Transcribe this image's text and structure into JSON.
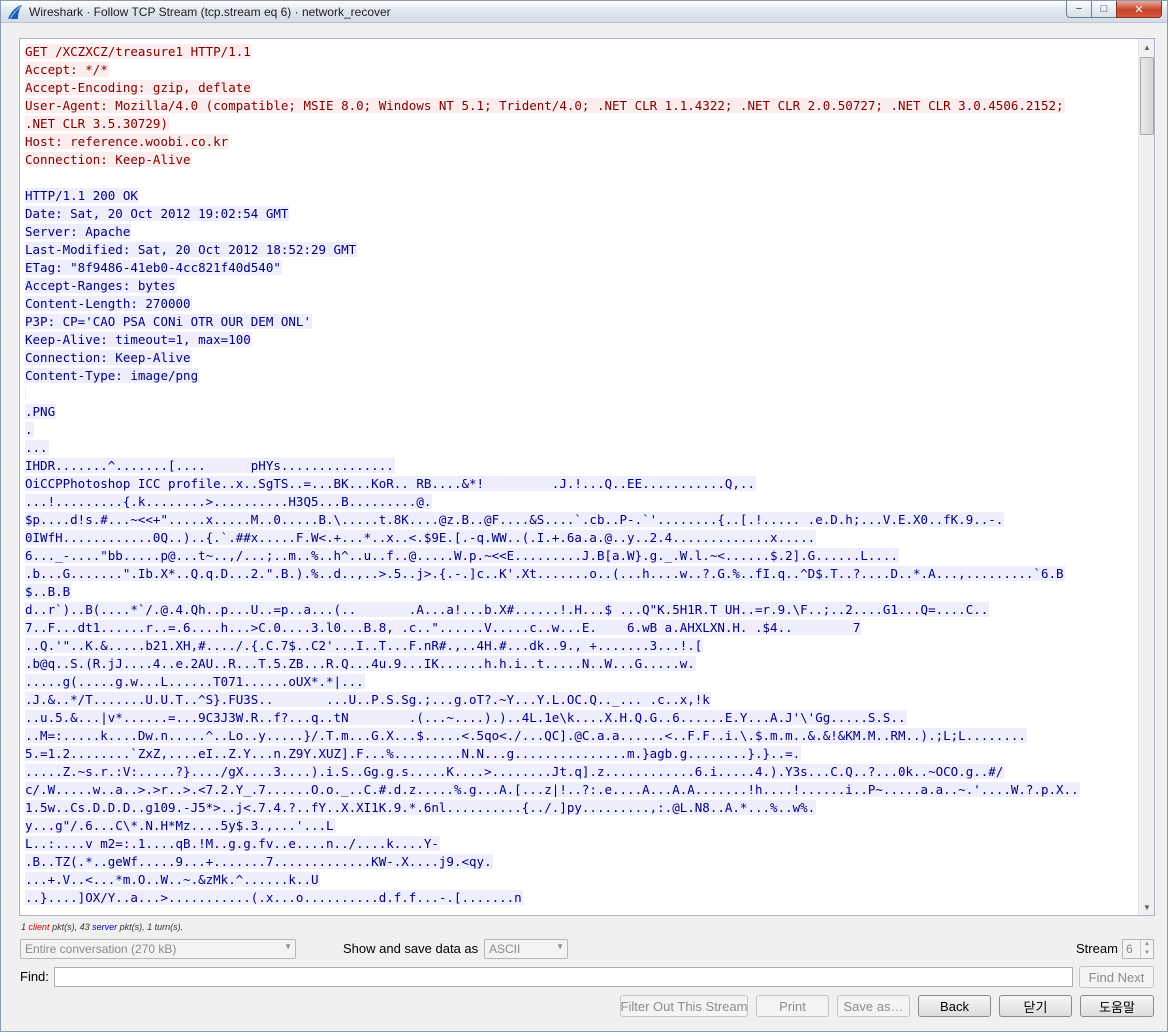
{
  "window": {
    "title": "Wireshark · Follow TCP Stream (tcp.stream eq 6) · network_recover",
    "minimize_glyph": "−",
    "maximize_glyph": "□",
    "close_glyph": "✕"
  },
  "stream": {
    "lines": [
      {
        "dir": "cli",
        "text": "GET /XCZXCZ/treasure1 HTTP/1.1"
      },
      {
        "dir": "cli",
        "text": "Accept: */*"
      },
      {
        "dir": "cli",
        "text": "Accept-Encoding: gzip, deflate"
      },
      {
        "dir": "cli",
        "text": "User-Agent: Mozilla/4.0 (compatible; MSIE 8.0; Windows NT 5.1; Trident/4.0; .NET CLR 1.1.4322; .NET CLR 2.0.50727; .NET CLR 3.0.4506.2152;"
      },
      {
        "dir": "cli",
        "text": ".NET CLR 3.5.30729)"
      },
      {
        "dir": "cli",
        "text": "Host: reference.woobi.co.kr"
      },
      {
        "dir": "cli",
        "text": "Connection: Keep-Alive"
      },
      {
        "dir": "blank",
        "text": ""
      },
      {
        "dir": "srv",
        "text": "HTTP/1.1 200 OK"
      },
      {
        "dir": "srv",
        "text": "Date: Sat, 20 Oct 2012 19:02:54 GMT"
      },
      {
        "dir": "srv",
        "text": "Server: Apache"
      },
      {
        "dir": "srv",
        "text": "Last-Modified: Sat, 20 Oct 2012 18:52:29 GMT"
      },
      {
        "dir": "srv",
        "text": "ETag: \"8f9486-41eb0-4cc821f40d540\""
      },
      {
        "dir": "srv",
        "text": "Accept-Ranges: bytes"
      },
      {
        "dir": "srv",
        "text": "Content-Length: 270000"
      },
      {
        "dir": "srv",
        "text": "P3P: CP='CAO PSA CONi OTR OUR DEM ONL'"
      },
      {
        "dir": "srv",
        "text": "Keep-Alive: timeout=1, max=100"
      },
      {
        "dir": "srv",
        "text": "Connection: Keep-Alive"
      },
      {
        "dir": "srv",
        "text": "Content-Type: image/png"
      },
      {
        "dir": "srv",
        "text": ""
      },
      {
        "dir": "srv",
        "text": ".PNG"
      },
      {
        "dir": "srv",
        "text": "."
      },
      {
        "dir": "srv",
        "text": "..."
      },
      {
        "dir": "srv",
        "text": "IHDR.......^.......[....      pHYs..............."
      },
      {
        "dir": "srv",
        "text": "OiCCPPhotoshop ICC profile..x..SgTS..=...BK...KoR.. RB....&*!         .J.!...Q..EE...........Q,.."
      },
      {
        "dir": "srv",
        "text": "...!.........{.k........>..........H3Q5...B.........@."
      },
      {
        "dir": "srv",
        "text": "$p....d!s.#...~<<+\".....x.....M..0.....B.\\.....t.8K....@z.B..@F....&S....`.cb..P-.`'........{..[.!..... .e.D.h;...V.E.X0..fK.9..-."
      },
      {
        "dir": "srv",
        "text": "0IWfH............0Q..)..{.`.##x.....F.W<.+...*..x..<.$9E.[.-q.WW..(.I.+.6a.a.@..y..2.4.............x....."
      },
      {
        "dir": "srv",
        "text": "6..._-....\"bb.....p@...t~..,/...;..m..%..h^..u..f..@.....W.p.~<<E.........J.B[a.W}.g._.W.l.~<......$.2].G......L...."
      },
      {
        "dir": "srv",
        "text": ".b...G.......\".Ib.X*..Q.q.D...2.\".B.).%..d..,..>.5..j>.{.-.]c..K'.Xt.......o..(...h....w..?.G.%..fI.q..^D$.T..?....D..*.A...,.........`6.B"
      },
      {
        "dir": "srv",
        "text": "$..B.B"
      },
      {
        "dir": "srv",
        "text": "d..r`)..B(....*`/.@.4.Qh..p...U..=p..a...(..       .A...a!...b.X#......!.H...$ ...Q\"K.5H1R.T UH..=r.9.\\F..;..2....G1...Q=....C.."
      },
      {
        "dir": "srv",
        "text": "7..F...dt1......r..=.6....h...>C.0....3.l0...B.8, .c..\"......V.....c..w...E.    6.wB a.AHXLXN.H. .$4..        7"
      },
      {
        "dir": "srv",
        "text": "..Q.'\"..K.&.....b21.XH,#..../.{.C.7$..C2'...I..T...F.nR#.,..4H.#...dk..9., +.......3...!.["
      },
      {
        "dir": "srv",
        "text": ".b@q..S.(R.jJ....4..e.2AU..R...T.5.ZB...R.Q...4u.9...IK......h.h.i..t.....N..W...G.....w."
      },
      {
        "dir": "srv",
        "text": ".....g(.....g.w...L......T071......oUX*.*|..."
      },
      {
        "dir": "srv",
        "text": ".J.&..*/T.......U.U.T..^S}.FU3S..       ...U..P.S.Sg.;...g.oT?.~Y...Y.L.OC.Q.._... .c..x,!k"
      },
      {
        "dir": "srv",
        "text": "..u.5.&...|v*......=...9C3J3W.R..f?...q..tN        .(...~....).)..4L.1e\\k....X.H.Q.G..6......E.Y...A.J'\\'Gg.....S.S.."
      },
      {
        "dir": "srv",
        "text": "..M=:.....k....Dw.n.....^..Lo..y.....}/.T.m...G.X...$.....<.5qo<./...QC].@C.a.a......<..F.F..i.\\.$.m.m..&.&!&KM.M..RM..).;L;L........"
      },
      {
        "dir": "srv",
        "text": "5.=1.2........`ZxZ,....eI..Z.Y...n.Z9Y.XUZ].F...%.........N.N...g...............m.}agb.g........}.}..=."
      },
      {
        "dir": "srv",
        "text": ".....Z.~s.r.:V:.....?}..../gX....3....).i.S..Gg.g.s.....K....>........Jt.q].z............6.i.....4.).Y3s...C.Q..?...0k..~OCO.g..#/"
      },
      {
        "dir": "srv",
        "text": "c/.W.....w..a..>.>r..>.<7.2.Y_.7......O.o._..C.#.d.z.....%.g...A.[...z|!..?:.e....A...A.A.......!h....!......i..P~.....a.a..~.'....W.?.p.X.."
      },
      {
        "dir": "srv",
        "text": "1.5w..Cs.D.D.D..g109.-J5*>..j<.7.4.?..fY..X.XI1K.9.*.6nl..........{../.]py.........,:.@L.N8..A.*...%..w%."
      },
      {
        "dir": "srv",
        "text": "y...g\"/.6...C\\*.N.H*Mz....5y$.3.,...'...L"
      },
      {
        "dir": "srv",
        "text": "L..:....v m2=:.1....qB.!M..g.g.fv..e....n../....k....Y-"
      },
      {
        "dir": "srv",
        "text": ".B..TZ(.*..geWf.....9...+.......7.............KW-.X....j9.<qy."
      },
      {
        "dir": "srv",
        "text": "...+.V..<...*m.O..W..~.&zMk.^......k..U"
      },
      {
        "dir": "srv",
        "text": "..}....]OX/Y..a...>...........(.x...o..........d.f.f...-.[.......n"
      }
    ]
  },
  "stats": {
    "client_count": "1",
    "client_word": "client",
    "client_suffix": "pkt(s),",
    "server_count": "43",
    "server_word": "server",
    "server_suffix": "pkt(s), 1 turn(s)."
  },
  "controls": {
    "conversation_value": "Entire conversation (270 kB)",
    "show_save_label": "Show and save data as",
    "format_value": "ASCII",
    "stream_label": "Stream",
    "stream_value": "6",
    "find_label": "Find:",
    "find_placeholder": "",
    "find_next_label": "Find Next",
    "filter_out_label": "Filter Out This Stream",
    "print_label": "Print",
    "save_as_label": "Save as…",
    "back_label": "Back",
    "close_label": "닫기",
    "help_label": "도움말"
  },
  "colors": {
    "client_text": "#7f0000",
    "client_bg": "#fbeded",
    "server_text": "#00007f",
    "server_bg": "#ededfb"
  },
  "icons": {
    "app": "wireshark-fin-icon",
    "dropdown": "chevron-down-icon",
    "scroll_up": "arrow-up-icon",
    "scroll_down": "arrow-down-icon"
  }
}
